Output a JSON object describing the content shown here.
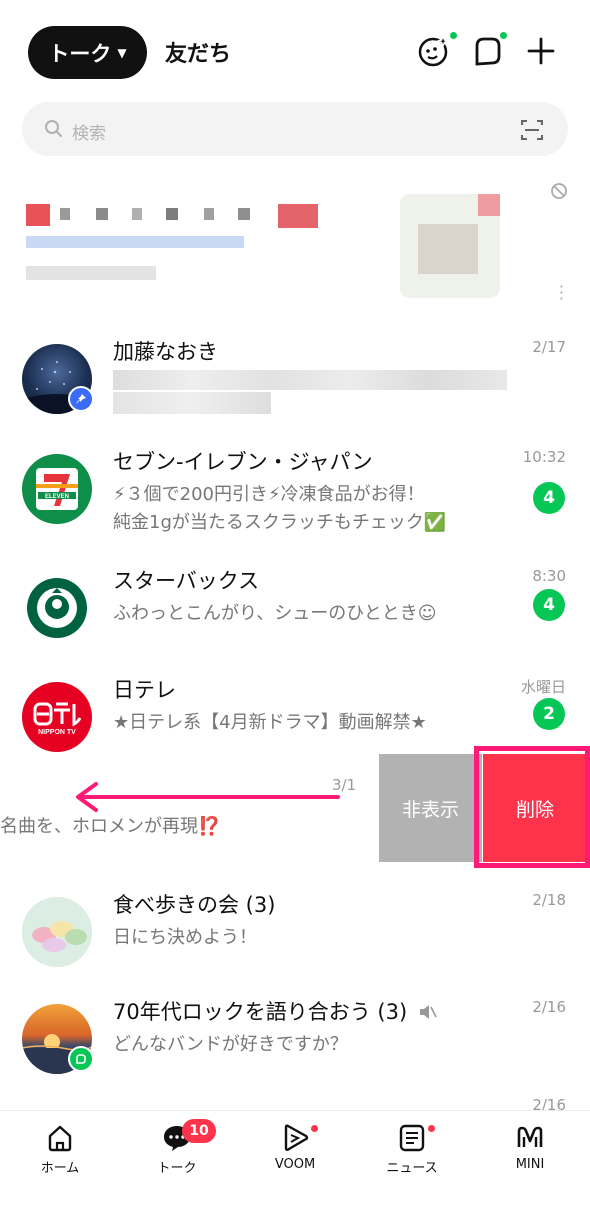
{
  "header": {
    "talk_label": "トーク",
    "friends_label": "友だち",
    "icons": [
      "sparkle-face-icon",
      "chat-bubble-icon",
      "plus-icon"
    ]
  },
  "search": {
    "placeholder": "検索",
    "icons": [
      "search-icon",
      "qr-scan-icon"
    ]
  },
  "ad": {
    "icons": [
      "hide-ad-icon",
      "more-vert-icon"
    ]
  },
  "chats": [
    {
      "name": "加藤なおき",
      "time": "2/17",
      "pinned": true
    },
    {
      "name": "セブン-イレブン・ジャパン",
      "time": "10:32",
      "msg1": "⚡３個で200円引き⚡冷凍食品がお得！",
      "msg2": "純金1gが当たるスクラッチもチェック✅",
      "badge": "4"
    },
    {
      "name": "スターバックス",
      "time": "8:30",
      "msg1": "ふわっとこんがり、シューのひととき☺",
      "badge": "4"
    },
    {
      "name": "日テレ",
      "time": "水曜日",
      "msg1": "★日テレ系【4月新ドラマ】動画解禁★",
      "badge": "2"
    },
    {
      "name": "食べ歩きの会 (3)",
      "time": "2/18",
      "msg1": "日にち決めよう！"
    },
    {
      "name": "70年代ロックを語り合おう (3)",
      "time": "2/16",
      "msg1": "どんなバンドが好きですか？",
      "muted": true
    },
    {
      "name": "",
      "time": "2/16"
    }
  ],
  "swiped": {
    "msg": "名曲を、ホロメンが再現⁉️",
    "time": "3/1",
    "hide_label": "非表示",
    "delete_label": "削除",
    "arrow_color": "#ff1a75"
  },
  "nav": [
    {
      "label": "ホーム",
      "icon": "home-icon"
    },
    {
      "label": "トーク",
      "icon": "talk-icon",
      "badge": "10"
    },
    {
      "label": "VOOM",
      "icon": "voom-icon",
      "dot": true
    },
    {
      "label": "ニュース",
      "icon": "news-icon",
      "dot": true
    },
    {
      "label": "MINI",
      "icon": "mini-icon"
    }
  ],
  "colors": {
    "accent": "#06c755",
    "danger": "#ff334b",
    "hide": "#b2b2b2"
  }
}
